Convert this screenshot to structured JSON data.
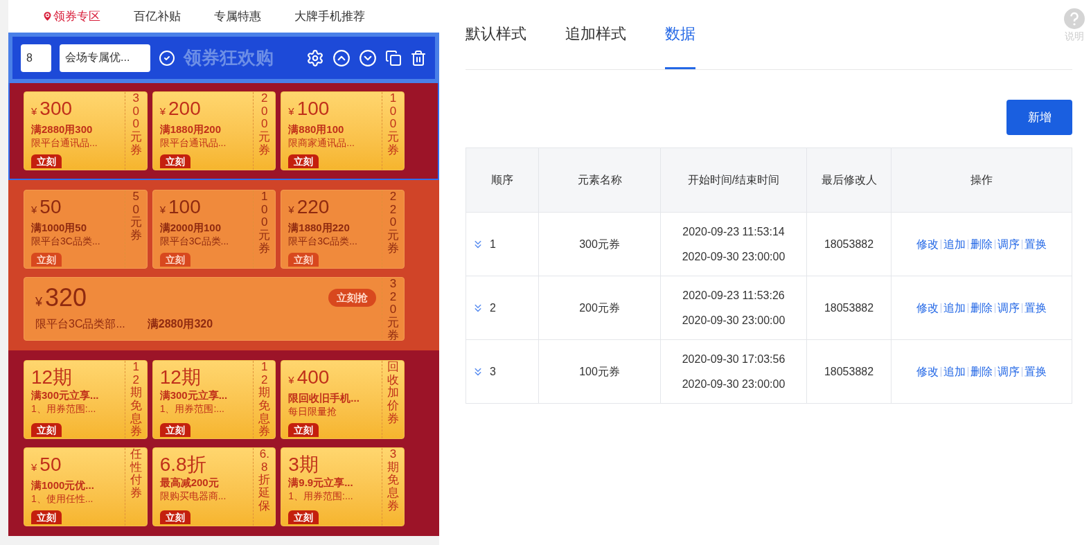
{
  "nav_tabs": [
    {
      "label": "领券专区",
      "selected": true
    },
    {
      "label": "百亿补贴",
      "selected": false
    },
    {
      "label": "专属特惠",
      "selected": false
    },
    {
      "label": "大牌手机推荐",
      "selected": false
    }
  ],
  "toolbar": {
    "order": "8",
    "name": "会场专属优...",
    "title": "领券狂欢购"
  },
  "sections": [
    {
      "kind": "gold",
      "selected": true,
      "coupons": [
        {
          "kind": "small",
          "currency": "¥",
          "amount": "300",
          "condition": "满2880用300",
          "desc": "限平台通讯品...",
          "badge": "立刻",
          "side": "300元券"
        },
        {
          "kind": "small",
          "currency": "¥",
          "amount": "200",
          "condition": "满1880用200",
          "desc": "限平台通讯品...",
          "badge": "立刻",
          "side": "200元券"
        },
        {
          "kind": "small",
          "currency": "¥",
          "amount": "100",
          "condition": "满880用100",
          "desc": "限商家通讯品...",
          "badge": "立刻",
          "side": "100元券"
        }
      ]
    },
    {
      "kind": "faded",
      "selected": false,
      "coupons": [
        {
          "kind": "small",
          "currency": "¥",
          "amount": "50",
          "condition": "满1000用50",
          "desc": "限平台3C品类...",
          "badge": "立刻",
          "side": "50元券"
        },
        {
          "kind": "small",
          "currency": "¥",
          "amount": "100",
          "condition": "满2000用100",
          "desc": "限平台3C品类...",
          "badge": "立刻",
          "side": "100元券"
        },
        {
          "kind": "small",
          "currency": "¥",
          "amount": "220",
          "condition": "满1880用220",
          "desc": "限平台3C品类...",
          "badge": "立刻",
          "side": "220元券"
        },
        {
          "kind": "wide",
          "currency": "¥",
          "amount": "320",
          "condition": "满2880用320",
          "desc": "限平台3C品类部...",
          "badge": "立刻抢",
          "side": "320元券"
        }
      ]
    },
    {
      "kind": "gold",
      "selected": false,
      "coupons": [
        {
          "kind": "small",
          "amount": "12期",
          "condition": "满300元立享...",
          "desc": "1、用券范围:...",
          "badge": "立刻",
          "side": "12期免息券"
        },
        {
          "kind": "small",
          "amount": "12期",
          "condition": "满300元立享...",
          "desc": "1、用券范围:...",
          "badge": "立刻",
          "side": "12期免息券"
        },
        {
          "kind": "small",
          "currency": "¥",
          "amount": "400",
          "condition": "限回收旧手机...",
          "desc": "每日限量抢",
          "badge": "立刻",
          "side": "回收加价券"
        },
        {
          "kind": "small",
          "currency": "¥",
          "amount": "50",
          "condition": "满1000元优...",
          "desc": "1、使用任性...",
          "badge": "立刻",
          "side": "任性付券"
        },
        {
          "kind": "small",
          "amount": "6.8折",
          "condition": "最高减200元",
          "desc": "限购买电器商...",
          "badge": "立刻",
          "side": "6.8折延保"
        },
        {
          "kind": "small",
          "amount": "3期",
          "condition": "满9.9元立享...",
          "desc": "1、用券范围:...",
          "badge": "立刻",
          "side": "3期免息券"
        }
      ]
    }
  ],
  "panel_tabs": [
    {
      "label": "默认样式",
      "selected": false
    },
    {
      "label": "追加样式",
      "selected": false
    },
    {
      "label": "数据",
      "selected": true
    }
  ],
  "help": "说明",
  "add_button": "新增",
  "table": {
    "columns": [
      "顺序",
      "元素名称",
      "开始时间/结束时间",
      "最后修改人",
      "操作"
    ],
    "rows": [
      {
        "order": "1",
        "name": "300元券",
        "start": "2020-09-23 11:53:14",
        "end": "2020-09-30 23:00:00",
        "editor": "18053882",
        "actions": [
          "修改",
          "追加",
          "删除",
          "调序",
          "置换"
        ]
      },
      {
        "order": "2",
        "name": "200元券",
        "start": "2020-09-23 11:53:26",
        "end": "2020-09-30 23:00:00",
        "editor": "18053882",
        "actions": [
          "修改",
          "追加",
          "删除",
          "调序",
          "置换"
        ]
      },
      {
        "order": "3",
        "name": "100元券",
        "start": "2020-09-30 17:03:56",
        "end": "2020-09-30 23:00:00",
        "editor": "18053882",
        "actions": [
          "修改",
          "追加",
          "删除",
          "调序",
          "置换"
        ]
      }
    ]
  }
}
